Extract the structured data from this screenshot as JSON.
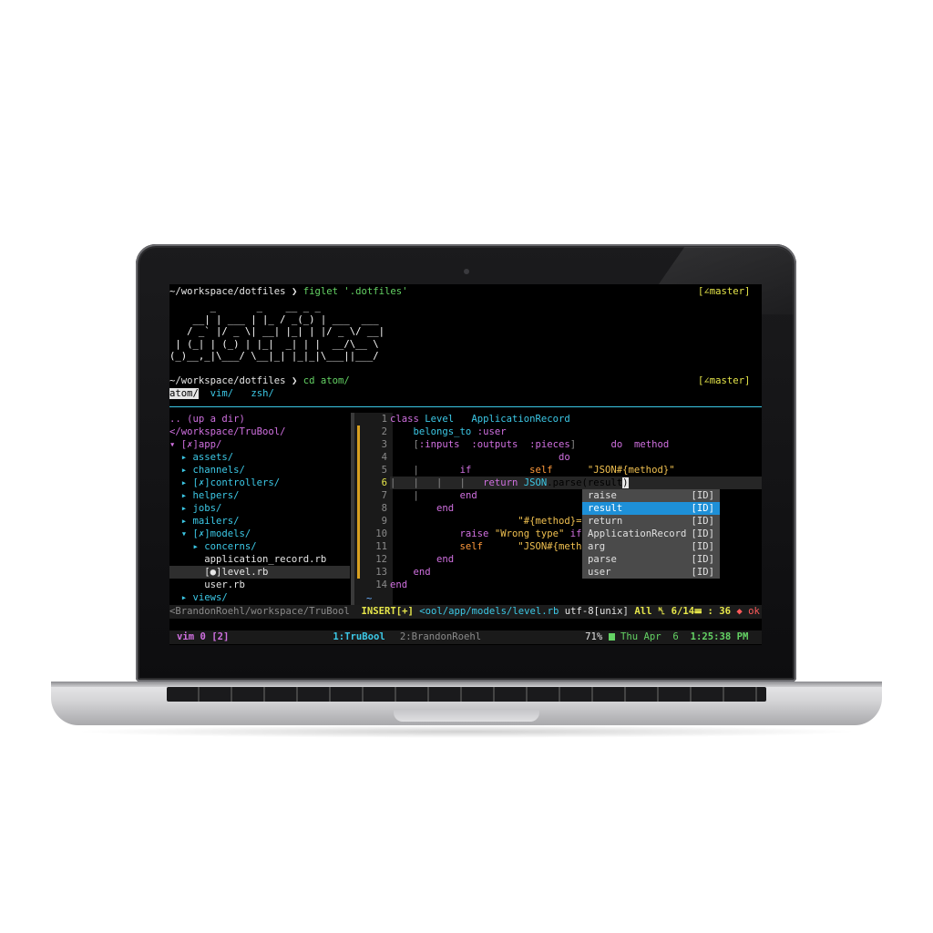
{
  "terminal": {
    "prompt1": {
      "path": "~/workspace/dotfiles",
      "arrow": "❯",
      "command": "figlet '.dotfiles'"
    },
    "branch": "[∠master]",
    "figlet": "       _       _    __ _ _\n    __| | ___ | |_ / _(_) | ___  ___\n   / _` |/ _ \\| __| |_| | |/ _ \\/ __|\n | (_| | (_) | |_|  _| | |  __/\\__ \\\n(_)__,_|\\___/ \\__|_| |_|_|\\___||___/",
    "prompt2": {
      "path": "~/workspace/dotfiles",
      "arrow": "❯",
      "command": "cd atom/"
    },
    "dirs": [
      "atom/",
      "vim/",
      "zsh/"
    ]
  },
  "tree": {
    "rows": [
      ".. (up a dir)",
      "</workspace/TruBool/",
      "▾ [✗]app/",
      "  ▸ assets/",
      "  ▸ channels/",
      "  ▸ [✗]controllers/",
      "  ▸ helpers/",
      "  ▸ jobs/",
      "  ▸ mailers/",
      "  ▾ [✗]models/",
      "    ▸ concerns/",
      "      application_record.rb",
      "      [●]level.rb",
      "      user.rb",
      "  ▸ views/"
    ]
  },
  "editor": {
    "line_numbers": [
      "1",
      "2",
      "3",
      "4",
      "5",
      "6",
      "7",
      "8",
      "9",
      "10",
      "11",
      "12",
      "13",
      "14"
    ],
    "current_line": "6",
    "tilde": "~"
  },
  "completion": {
    "items": [
      {
        "word": "raise",
        "kind": "[ID]"
      },
      {
        "word": "result",
        "kind": "[ID]"
      },
      {
        "word": "return",
        "kind": "[ID]"
      },
      {
        "word": "ApplicationRecord",
        "kind": "[ID]"
      },
      {
        "word": "arg",
        "kind": "[ID]"
      },
      {
        "word": "parse",
        "kind": "[ID]"
      },
      {
        "word": "user",
        "kind": "[ID]"
      }
    ],
    "selected": "result"
  },
  "statusline": {
    "left_path": "<BrandonRoehl/workspace/TruBool",
    "mode": "INSERT[+]",
    "file": "<ool/app/models/level.rb",
    "encoding": "utf-8[unix]",
    "position": "All ␤ 6/14☰ : 36",
    "lint": "◆ ok"
  },
  "tmux": {
    "session": "vim 0 [2]",
    "window1": "1:TruBool",
    "window2": "2:BrandonRoehl",
    "battery": "71%",
    "date": "Thu Apr  6",
    "time": "1:25:38 PM"
  }
}
